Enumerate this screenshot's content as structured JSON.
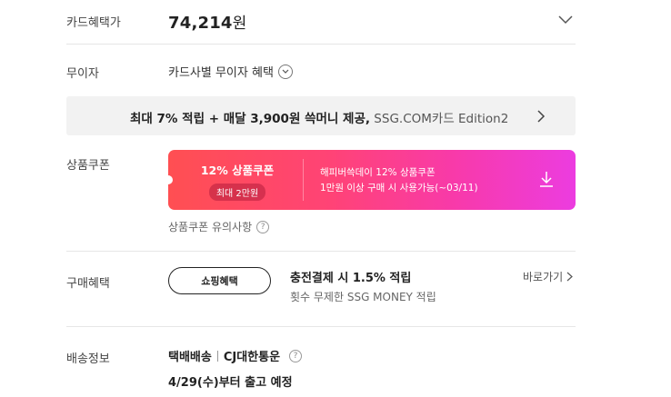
{
  "card_price": {
    "label": "카드혜택가",
    "amount": "74,214",
    "unit": "원"
  },
  "installment": {
    "label": "무이자",
    "text": "카드사별 무이자 혜택"
  },
  "promo_banner": {
    "text_bold": "최대 7% 적립 + 매달 3,900원 쓱머니 제공,",
    "text_light": " SSG.COM카드 Edition2"
  },
  "coupon": {
    "label": "상품쿠폰",
    "percent_text": "12% 상품쿠폰",
    "max_text": "최대 2만원",
    "desc_line1": "해피버쓱데이 12% 상품쿠폰",
    "desc_line2": "1만원 이상 구매 시 사용가능(~03/11)",
    "notice": "상품쿠폰 유의사항",
    "help": "?"
  },
  "purchase_benefit": {
    "label": "구매혜택",
    "button": "쇼핑혜택",
    "title": "충전결제 시 1.5% 적립",
    "subtitle": "횟수 무제한 SSG MONEY 적립",
    "link": "바로가기"
  },
  "shipping": {
    "label": "배송정보",
    "method": "택배배송",
    "carrier": "CJ대한통운",
    "help": "?",
    "schedule": "4/29(수)부터 출고 예정"
  },
  "colors": {
    "coupon_gradient_start": "#ff4f52",
    "coupon_gradient_end": "#ec3ce0",
    "banner_bg": "#f2f2f2"
  }
}
